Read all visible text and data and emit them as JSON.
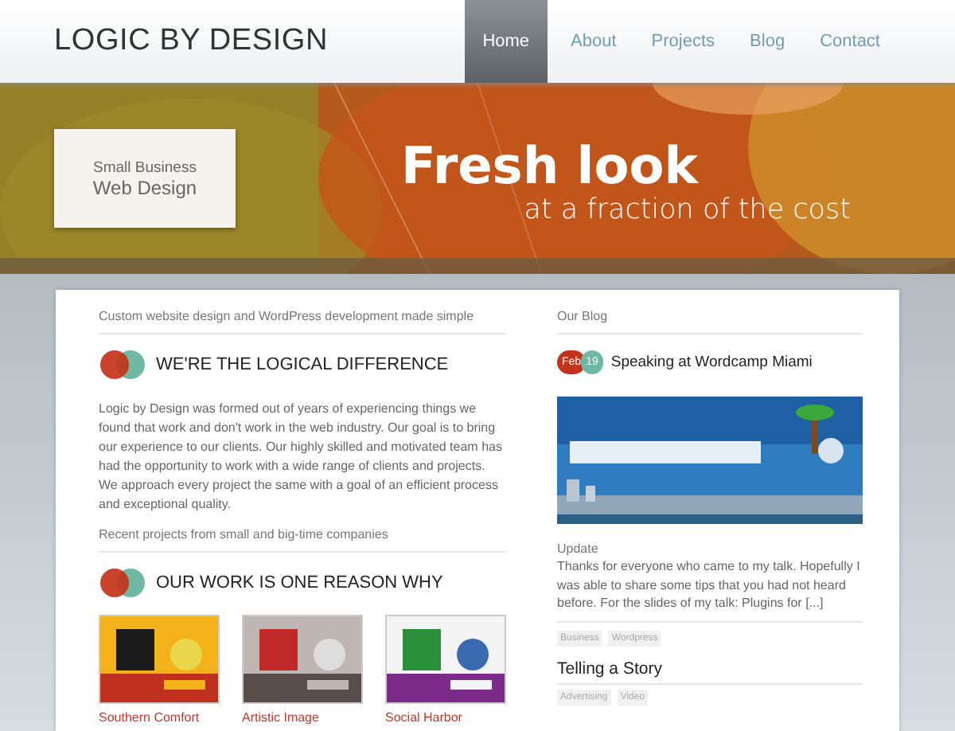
{
  "logo": "LOGIC BY DESIGN",
  "nav": [
    {
      "label": "Home",
      "selected": true
    },
    {
      "label": "About",
      "selected": false
    },
    {
      "label": "Projects",
      "selected": false
    },
    {
      "label": "Blog",
      "selected": false
    },
    {
      "label": "Contact",
      "selected": false
    }
  ],
  "hero": {
    "badge": [
      "Small Business",
      "Web Design"
    ],
    "headline": "Fresh look",
    "subline": "at a fraction of the cost"
  },
  "main": {
    "intro": "Custom website design and WordPress development made simple",
    "heading": "WE'RE THE LOGICAL DIFFERENCE",
    "body": "Logic by Design was formed out of years of experiencing things we found that work and don't work in the web industry. Our goal is to bring our experience to our clients. Our highly skilled and motivated team has had the opportunity to work with a wide range of clients and projects. We approach every project the same with a goal of an efficient process and exceptional quality.",
    "projects_intro": "Recent projects from small and big-time companies",
    "projects_heading": "OUR WORK IS ONE REASON WHY",
    "projects": [
      {
        "name": "Southern Comfort",
        "kind": "picture"
      },
      {
        "name": "Artistic Image",
        "kind": "picture"
      },
      {
        "name": "Social Harbor",
        "kind": "picture"
      }
    ]
  },
  "blog": {
    "title": "Our Blog",
    "posts": [
      {
        "month": "Feb",
        "day": "19",
        "title": "Speaking at Wordcamp Miami",
        "category": "Update",
        "excerpt": "Thanks for everyone who came to my talk. Hopefully I was able to share some tips that you had not heard before. For the slides of my talk: Plugins for [...]",
        "tags": [
          "Business",
          "Wordpress"
        ]
      },
      {
        "title": "Telling a Story",
        "tags": [
          "Advertising",
          "Video"
        ]
      }
    ]
  }
}
